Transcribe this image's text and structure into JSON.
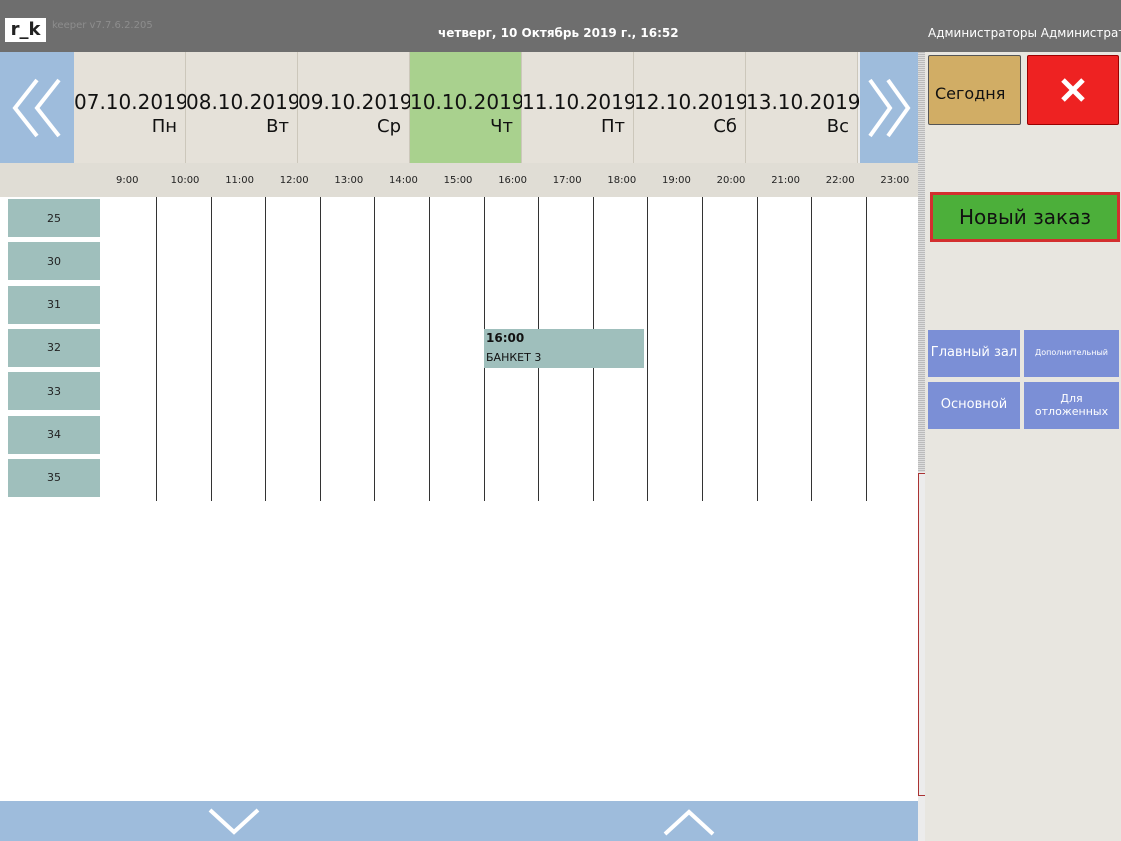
{
  "topbar": {
    "logo": "r_k",
    "version": "keeper v7.7.6.2.205",
    "datetime": "четверг, 10 Октябрь 2019 г., 16:52",
    "user": "Администраторы Администратор"
  },
  "days": [
    {
      "date": "07.10.2019",
      "weekday": "Пн",
      "active": false
    },
    {
      "date": "08.10.2019",
      "weekday": "Вт",
      "active": false
    },
    {
      "date": "09.10.2019",
      "weekday": "Ср",
      "active": false
    },
    {
      "date": "10.10.2019",
      "weekday": "Чт",
      "active": true
    },
    {
      "date": "11.10.2019",
      "weekday": "Пт",
      "active": false
    },
    {
      "date": "12.10.2019",
      "weekday": "Сб",
      "active": false
    },
    {
      "date": "13.10.2019",
      "weekday": "Вс",
      "active": false
    }
  ],
  "hours": [
    "9:00",
    "10:00",
    "11:00",
    "12:00",
    "13:00",
    "14:00",
    "15:00",
    "16:00",
    "17:00",
    "18:00",
    "19:00",
    "20:00",
    "21:00",
    "22:00",
    "23:00"
  ],
  "tables": [
    "25",
    "30",
    "31",
    "32",
    "33",
    "34",
    "35"
  ],
  "booking": {
    "time": "16:00",
    "name": "БАНКЕТ 3",
    "table": "32"
  },
  "right_panel": {
    "today_label": "Сегодня",
    "close_icon": "close-icon",
    "new_order_label": "Новый заказ",
    "halls": [
      {
        "label": "Главный зал",
        "size": 13
      },
      {
        "label": "Дополнительный",
        "size": 8
      },
      {
        "label": "Основной",
        "size": 13
      },
      {
        "label": "Для отложенных",
        "size": 11
      }
    ]
  },
  "colors": {
    "topbar": "#6e6e6e",
    "nav_blue": "#9ebcdc",
    "day_bg": "#e5e1d9",
    "day_active": "#a9d18e",
    "table_bg": "#9fbfbc",
    "today_button": "#d1ad65",
    "close_button": "#ee2222",
    "new_order_button": "#4caf3a",
    "hall_button": "#7b8fd6"
  }
}
